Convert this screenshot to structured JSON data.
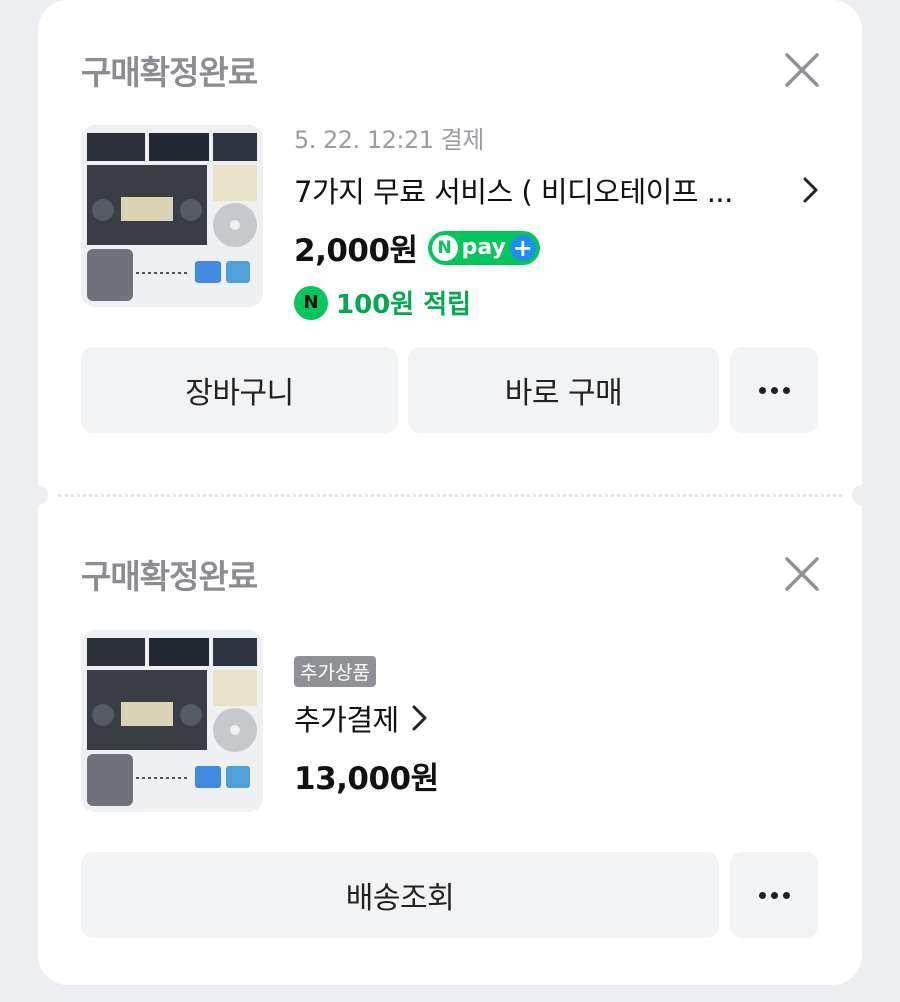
{
  "orders": [
    {
      "status": "구매확정완료",
      "date": "5. 22. 12:21 결제",
      "title": "7가지 무료 서비스 ( 비디오테이프 ...",
      "price": "2,000원",
      "npay_label": "pay",
      "reward": "100원 적립",
      "buttons": {
        "cart": "장바구니",
        "buy_now": "바로 구매"
      }
    },
    {
      "status": "구매확정완료",
      "tag": "추가상품",
      "title": "추가결제",
      "price": "13,000원",
      "buttons": {
        "tracking": "배송조회"
      }
    }
  ],
  "icons": {
    "close": "close-icon",
    "more": "more-horizontal-icon",
    "chevron": "chevron-right-icon",
    "npay": "npay-plus-badge",
    "naver": "naver-points-icon"
  },
  "colors": {
    "naver_green": "#03c75a",
    "plus_blue": "#1e8df5",
    "muted_gray": "#8b8d92",
    "button_bg": "#f2f3f5"
  }
}
